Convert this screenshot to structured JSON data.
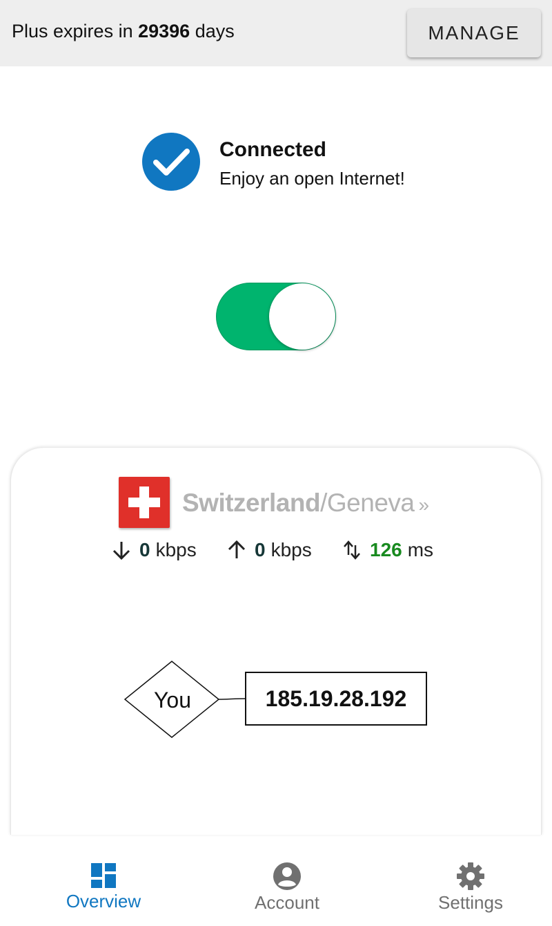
{
  "banner": {
    "prefix": "Plus expires in",
    "days": "29396",
    "suffix": "days",
    "manage_label": "MANAGE"
  },
  "status": {
    "title": "Connected",
    "subtitle": "Enjoy an open Internet!",
    "icon": "check-circle-icon",
    "toggle_on": true,
    "accent_color": "#1077c1",
    "toggle_color": "#00b46e"
  },
  "server": {
    "flag": "switzerland-flag-icon",
    "country": "Switzerland",
    "city": "/Geneva",
    "chevron": "»",
    "download_value": "0",
    "download_unit": "kbps",
    "upload_value": "0",
    "upload_unit": "kbps",
    "latency_value": "126",
    "latency_unit": "ms"
  },
  "diagram": {
    "you_label": "You",
    "ip": "185.19.28.192"
  },
  "nav": {
    "items": [
      {
        "label": "Overview",
        "icon": "dashboard-icon",
        "active": true
      },
      {
        "label": "Account",
        "icon": "account-circle-icon",
        "active": false
      },
      {
        "label": "Settings",
        "icon": "gear-icon",
        "active": false
      }
    ]
  }
}
